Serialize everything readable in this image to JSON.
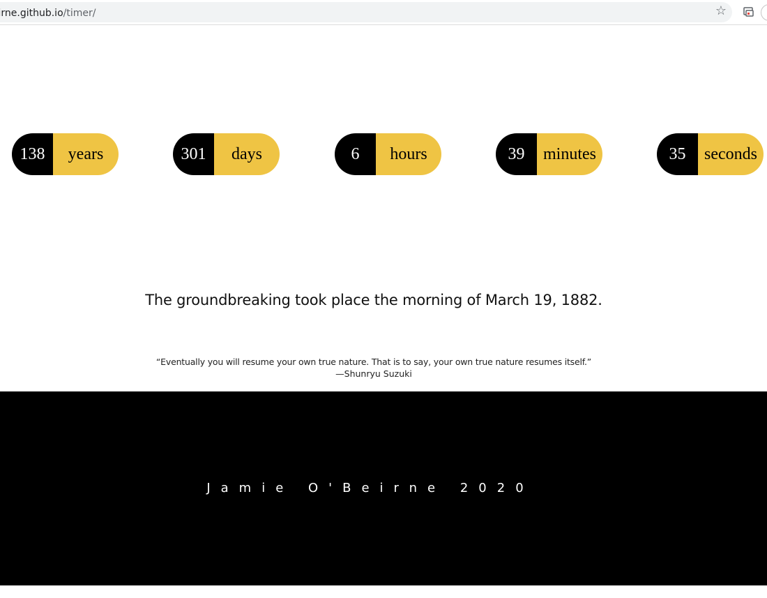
{
  "browser": {
    "url_host": "beirne.github.io",
    "url_path": "/timer/"
  },
  "timer": [
    {
      "value": "138",
      "unit": "years"
    },
    {
      "value": "301",
      "unit": "days"
    },
    {
      "value": "6",
      "unit": "hours"
    },
    {
      "value": "39",
      "unit": "minutes"
    },
    {
      "value": "35",
      "unit": "seconds"
    }
  ],
  "headline": "The groundbreaking took place the morning of March 19, 1882.",
  "quote": {
    "text": "“Eventually you will resume your own true nature. That is to say, your own true nature resumes itself.”",
    "author": "—Shunryu Suzuki"
  },
  "footer": {
    "text": "Jamie O'Beirne 2020"
  },
  "colors": {
    "accent": "#efc444",
    "dark": "#000000"
  }
}
